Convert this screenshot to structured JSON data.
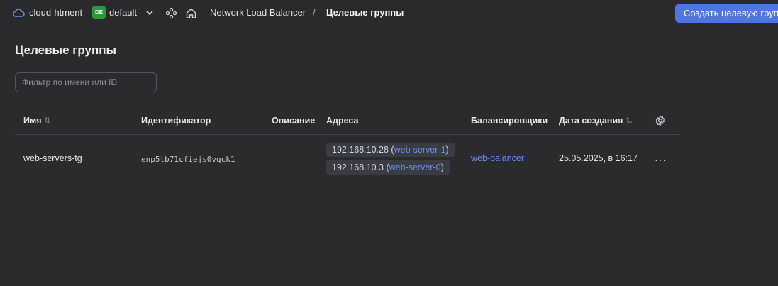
{
  "topbar": {
    "cloud_name": "cloud-htment",
    "folder_badge": "DE",
    "folder_name": "default",
    "service": "Network Load Balancer",
    "separator": "/",
    "page": "Целевые группы",
    "create_button": "Создать целевую группу"
  },
  "page": {
    "title": "Целевые группы",
    "filter_placeholder": "Фильтр по имени или ID"
  },
  "table": {
    "columns": {
      "name": "Имя",
      "id": "Идентификатор",
      "description": "Описание",
      "addresses": "Адреса",
      "balancers": "Балансировщики",
      "created": "Дата создания"
    },
    "sort_icon": "⇅",
    "rows": [
      {
        "name": "web-servers-tg",
        "id": "enp5tb71cfiejs0vqck1",
        "description": "—",
        "addresses": [
          {
            "ip": "192.168.10.28",
            "host": "web-server-1"
          },
          {
            "ip": "192.168.10.3",
            "host": "web-server-0"
          }
        ],
        "balancer": "web-balancer",
        "created": "25.05.2025, в 16:17",
        "menu": "···"
      }
    ]
  },
  "colors": {
    "background": "#2b2b2e",
    "accent": "#4f75de",
    "link": "#6b8ff0",
    "folder_badge": "#2c9a3a"
  }
}
